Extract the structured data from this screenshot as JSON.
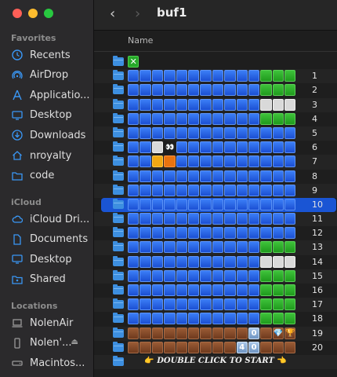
{
  "window": {
    "title": "buf1"
  },
  "colors": {
    "accent": "#1a55d4",
    "folder": "#3d8fe0"
  },
  "sidebar": {
    "sections": [
      {
        "label": "Favorites",
        "items": [
          {
            "label": "Recents",
            "icon": "clock-icon"
          },
          {
            "label": "AirDrop",
            "icon": "airdrop-icon"
          },
          {
            "label": "Applicatio...",
            "icon": "applications-icon"
          },
          {
            "label": "Desktop",
            "icon": "desktop-icon"
          },
          {
            "label": "Downloads",
            "icon": "downloads-icon"
          },
          {
            "label": "nroyalty",
            "icon": "home-icon"
          },
          {
            "label": "code",
            "icon": "folder-icon"
          }
        ]
      },
      {
        "label": "iCloud",
        "items": [
          {
            "label": "iCloud Dri...",
            "icon": "cloud-icon"
          },
          {
            "label": "Documents",
            "icon": "document-icon"
          },
          {
            "label": "Desktop",
            "icon": "desktop-icon"
          },
          {
            "label": "Shared",
            "icon": "shared-folder-icon"
          }
        ]
      },
      {
        "label": "Locations",
        "items": [
          {
            "label": "NolenAir",
            "icon": "laptop-icon"
          },
          {
            "label": "Nolen'...",
            "icon": "phone-icon"
          },
          {
            "label": "Macintos...",
            "icon": "disk-icon"
          }
        ]
      }
    ]
  },
  "header": {
    "name_column": "Name"
  },
  "rows": [
    {
      "label": "",
      "cells": "X"
    },
    {
      "label": "1",
      "cells": "BBBBBBBBBBBGGG"
    },
    {
      "label": "2",
      "cells": "BBBBBBBBBBBGGG"
    },
    {
      "label": "3",
      "cells": "BBBBBBBBBBBWWW"
    },
    {
      "label": "4",
      "cells": "BBBBBBBBBBBGGG"
    },
    {
      "label": "5",
      "cells": "BBBBBBBBBBBBBB"
    },
    {
      "label": "6",
      "cells": "BBWEBBBBBBBBBB"
    },
    {
      "label": "7",
      "cells": "BBYOBBBBBBBBBB"
    },
    {
      "label": "8",
      "cells": "BBBBBBBBBBBBBB"
    },
    {
      "label": "9",
      "cells": "BBBBBBBBBBBBBB"
    },
    {
      "label": "10",
      "cells": "BBBBBBBBBBBBBB",
      "selected": true
    },
    {
      "label": "11",
      "cells": "BBBBBBBBBBBBBB"
    },
    {
      "label": "12",
      "cells": "BBBBBBBBBBBBBB"
    },
    {
      "label": "13",
      "cells": "BBBBBBBBBBBGGG"
    },
    {
      "label": "14",
      "cells": "BBBBBBBBBBBWWW"
    },
    {
      "label": "15",
      "cells": "BBBBBBBBBBBGGG"
    },
    {
      "label": "16",
      "cells": "BBBBBBBBBBBGGG"
    },
    {
      "label": "17",
      "cells": "BBBBBBBBBBBGGG"
    },
    {
      "label": "18",
      "cells": "BBBBBBBBBBBGGG"
    },
    {
      "label": "19",
      "cells": "DDDDDDDDDDN.MT",
      "nums": [
        "0"
      ]
    },
    {
      "label": "20",
      "cells": "DDDDDDDDDNNDDD",
      "nums": [
        "4",
        "0"
      ]
    }
  ],
  "footer": {
    "start_text": "DOUBLE CLICK TO START",
    "hand_left": "👉",
    "hand_right": "👈"
  },
  "glyphs": {
    "x_mark": "✕",
    "eyes": "👀",
    "gem": "💎",
    "trophy": "🏆"
  }
}
